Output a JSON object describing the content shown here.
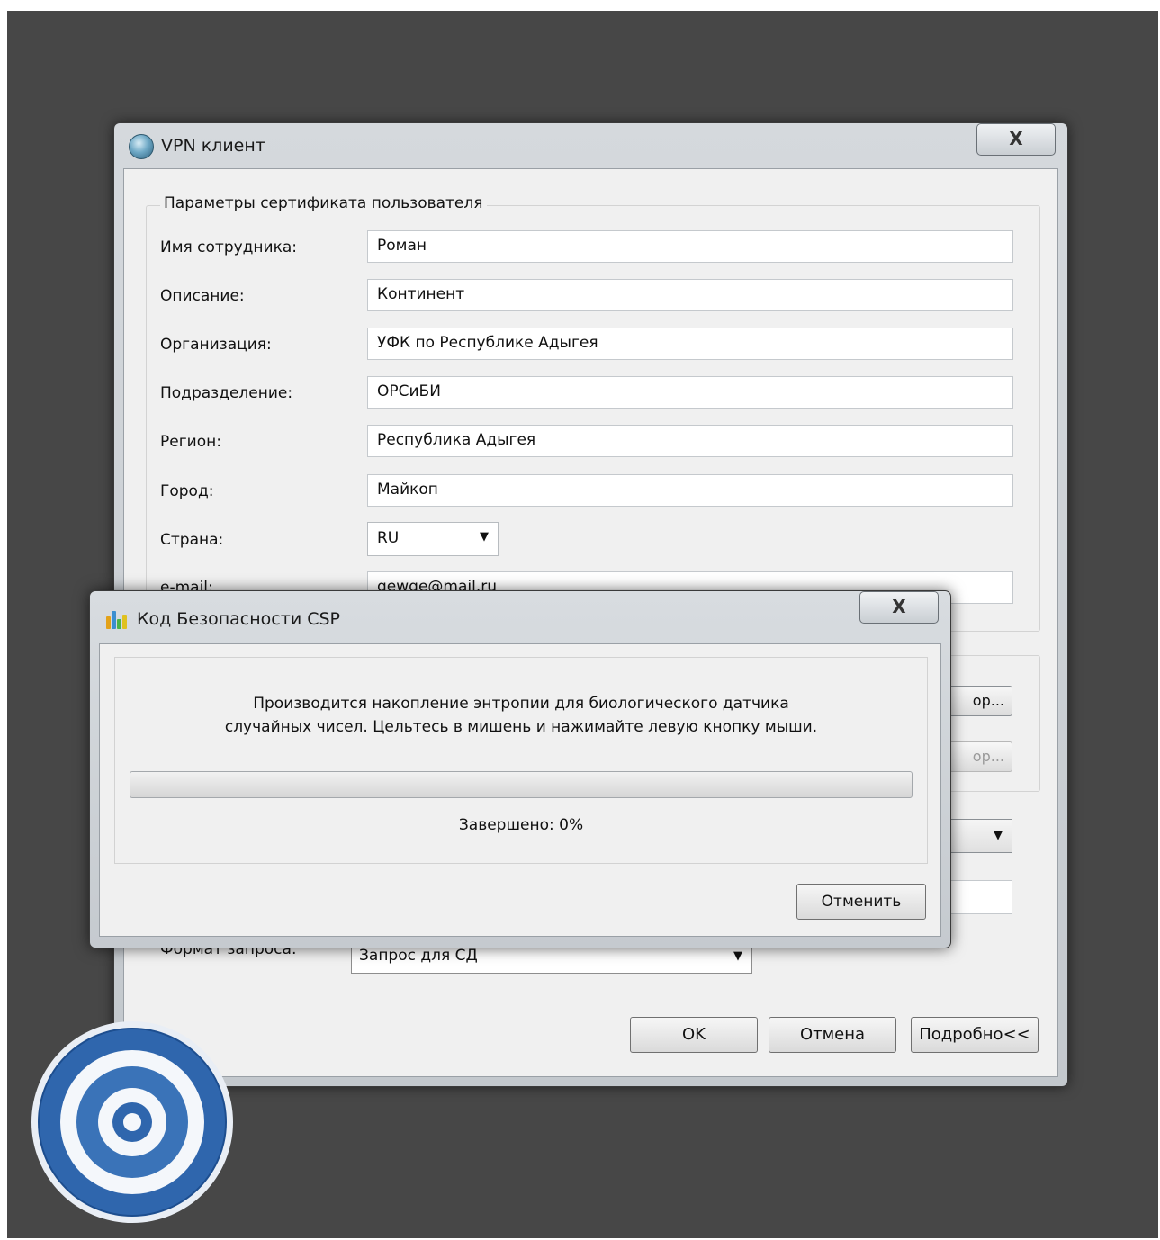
{
  "main_window": {
    "title": "VPN клиент",
    "close_label": "X",
    "group_title": "Параметры сертификата пользователя",
    "fields": [
      {
        "label": "Имя сотрудника:",
        "value": "Роман"
      },
      {
        "label": "Описание:",
        "value": "Континент"
      },
      {
        "label": "Организация:",
        "value": "УФК по Республике Адыгея"
      },
      {
        "label": "Подразделение:",
        "value": "ОРСиБИ"
      },
      {
        "label": "Регион:",
        "value": "Республика Адыгея"
      },
      {
        "label": "Город:",
        "value": "Майкоп"
      }
    ],
    "country": {
      "label": "Страна:",
      "value": "RU"
    },
    "email": {
      "label": "e-mail:",
      "value": "qewqe@mail.ru"
    },
    "browse_label_1": "ор...",
    "browse_label_2": "ор...",
    "request_format": {
      "label": "Формат запроса:",
      "value": "Запрос для СД"
    },
    "buttons": {
      "ok": "OK",
      "cancel": "Отмена",
      "details": "Подробно<<"
    }
  },
  "csp_dialog": {
    "title": "Код Безопасности CSP",
    "close_label": "X",
    "message_line1": "Производится накопление энтропии для биологического датчика",
    "message_line2": "случайных чисел. Цельтесь в мишень и нажимайте левую кнопку мыши.",
    "progress_text": "Завершено: 0%",
    "progress_fraction": 0,
    "cancel_label": "Отменить"
  }
}
